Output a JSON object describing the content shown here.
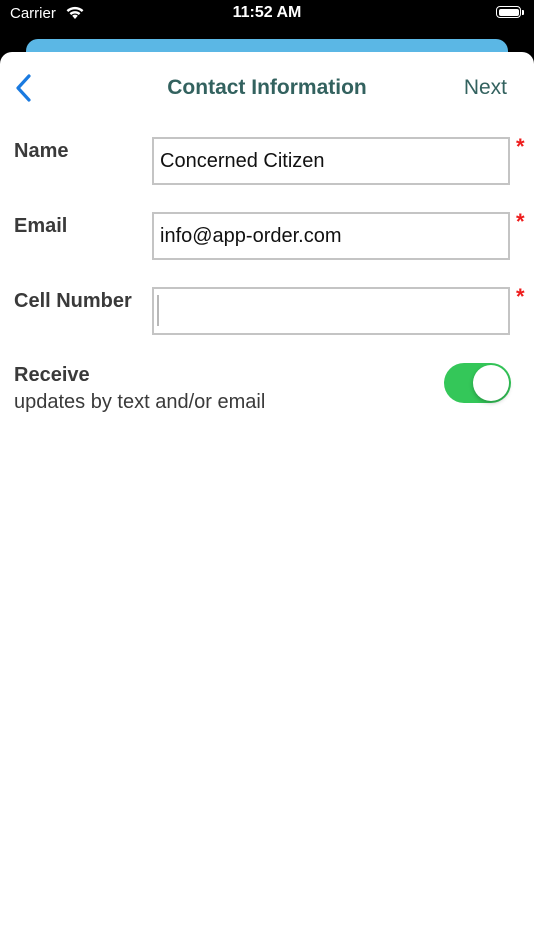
{
  "status_bar": {
    "carrier": "Carrier",
    "time": "11:52 AM",
    "icons": [
      "wifi-icon",
      "battery-icon"
    ]
  },
  "nav": {
    "back_icon": "chevron-left-icon",
    "title": "Contact Information",
    "next_label": "Next"
  },
  "form": {
    "name": {
      "label": "Name",
      "value": "Concerned Citizen",
      "required_mark": "*"
    },
    "email": {
      "label": "Email",
      "value": "info@app-order.com",
      "required_mark": "*"
    },
    "cell": {
      "label": "Cell Number",
      "value": "",
      "required_mark": "*"
    },
    "receive": {
      "label": "Receive",
      "sublabel": "updates by text and/or email",
      "enabled": true
    }
  },
  "colors": {
    "accent_blue": "#1a7ae0",
    "title_teal": "#33625f",
    "header_card_blue": "#5bb7e5",
    "toggle_on_green": "#34c759",
    "required_red": "#ee1c1c"
  }
}
